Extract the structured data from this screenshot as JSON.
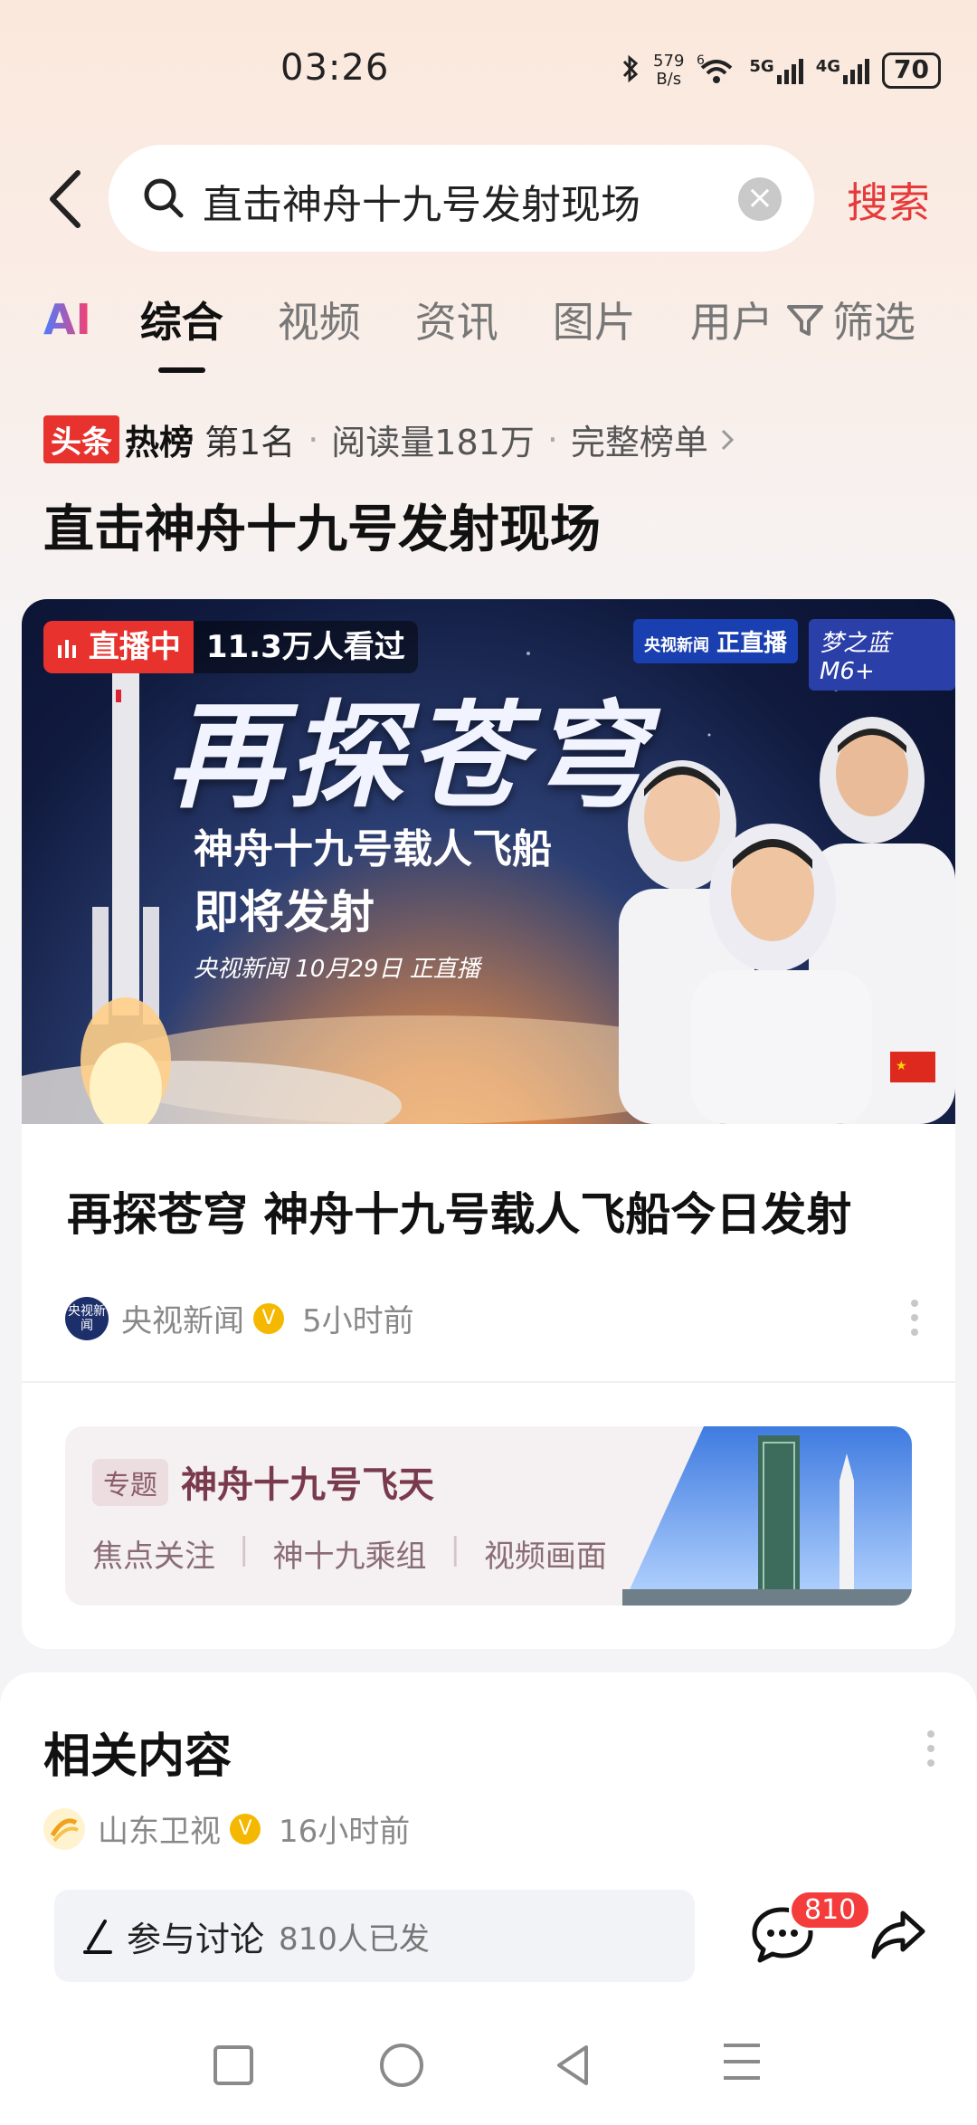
{
  "status": {
    "time": "03:26",
    "net_speed": "579",
    "net_unit": "B/s",
    "signal1": "6",
    "signal2": "5G",
    "signal3": "4G",
    "battery": "70"
  },
  "search": {
    "query": "直击神舟十九号发射现场",
    "button": "搜索"
  },
  "tabs": [
    {
      "label": "AI"
    },
    {
      "label": "综合"
    },
    {
      "label": "视频"
    },
    {
      "label": "资讯"
    },
    {
      "label": "图片"
    },
    {
      "label": "用户"
    }
  ],
  "filter_label": "筛选",
  "hot": {
    "brand1": "头条",
    "brand2": "热榜",
    "rank": "第1名",
    "reads": "阅读量181万",
    "full_list": "完整榜单"
  },
  "topic_heading": "直击神舟十九号发射现场",
  "card": {
    "live_label": "直播中",
    "viewers": "11.3万人看过",
    "cctv_logo": "央视新闻",
    "cctv_live": "正直播",
    "sponsor": "梦之蓝 M6+",
    "banner_title": "再探苍穹",
    "banner_sub1": "神舟十九号载人飞船",
    "banner_sub2": "即将发射",
    "banner_sub3": "央视新闻 10月29日 正直播",
    "title": "再探苍穹 神舟十九号载人飞船今日发射",
    "source": "央视新闻",
    "source_logo_text": "央视新闻",
    "time": "5小时前"
  },
  "topic": {
    "tag": "专题",
    "title": "神舟十九号飞天",
    "links": [
      "焦点关注",
      "神十九乘组",
      "视频画面"
    ]
  },
  "related": {
    "title": "相关内容",
    "source": "山东卫视",
    "time": "16小时前"
  },
  "bottom": {
    "discuss_label": "参与讨论",
    "discuss_count": "810人已发",
    "comment_count": "810"
  },
  "colors": {
    "accent": "#e63a3a",
    "live": "#e8322e",
    "topic_text": "#7a3a4e"
  }
}
